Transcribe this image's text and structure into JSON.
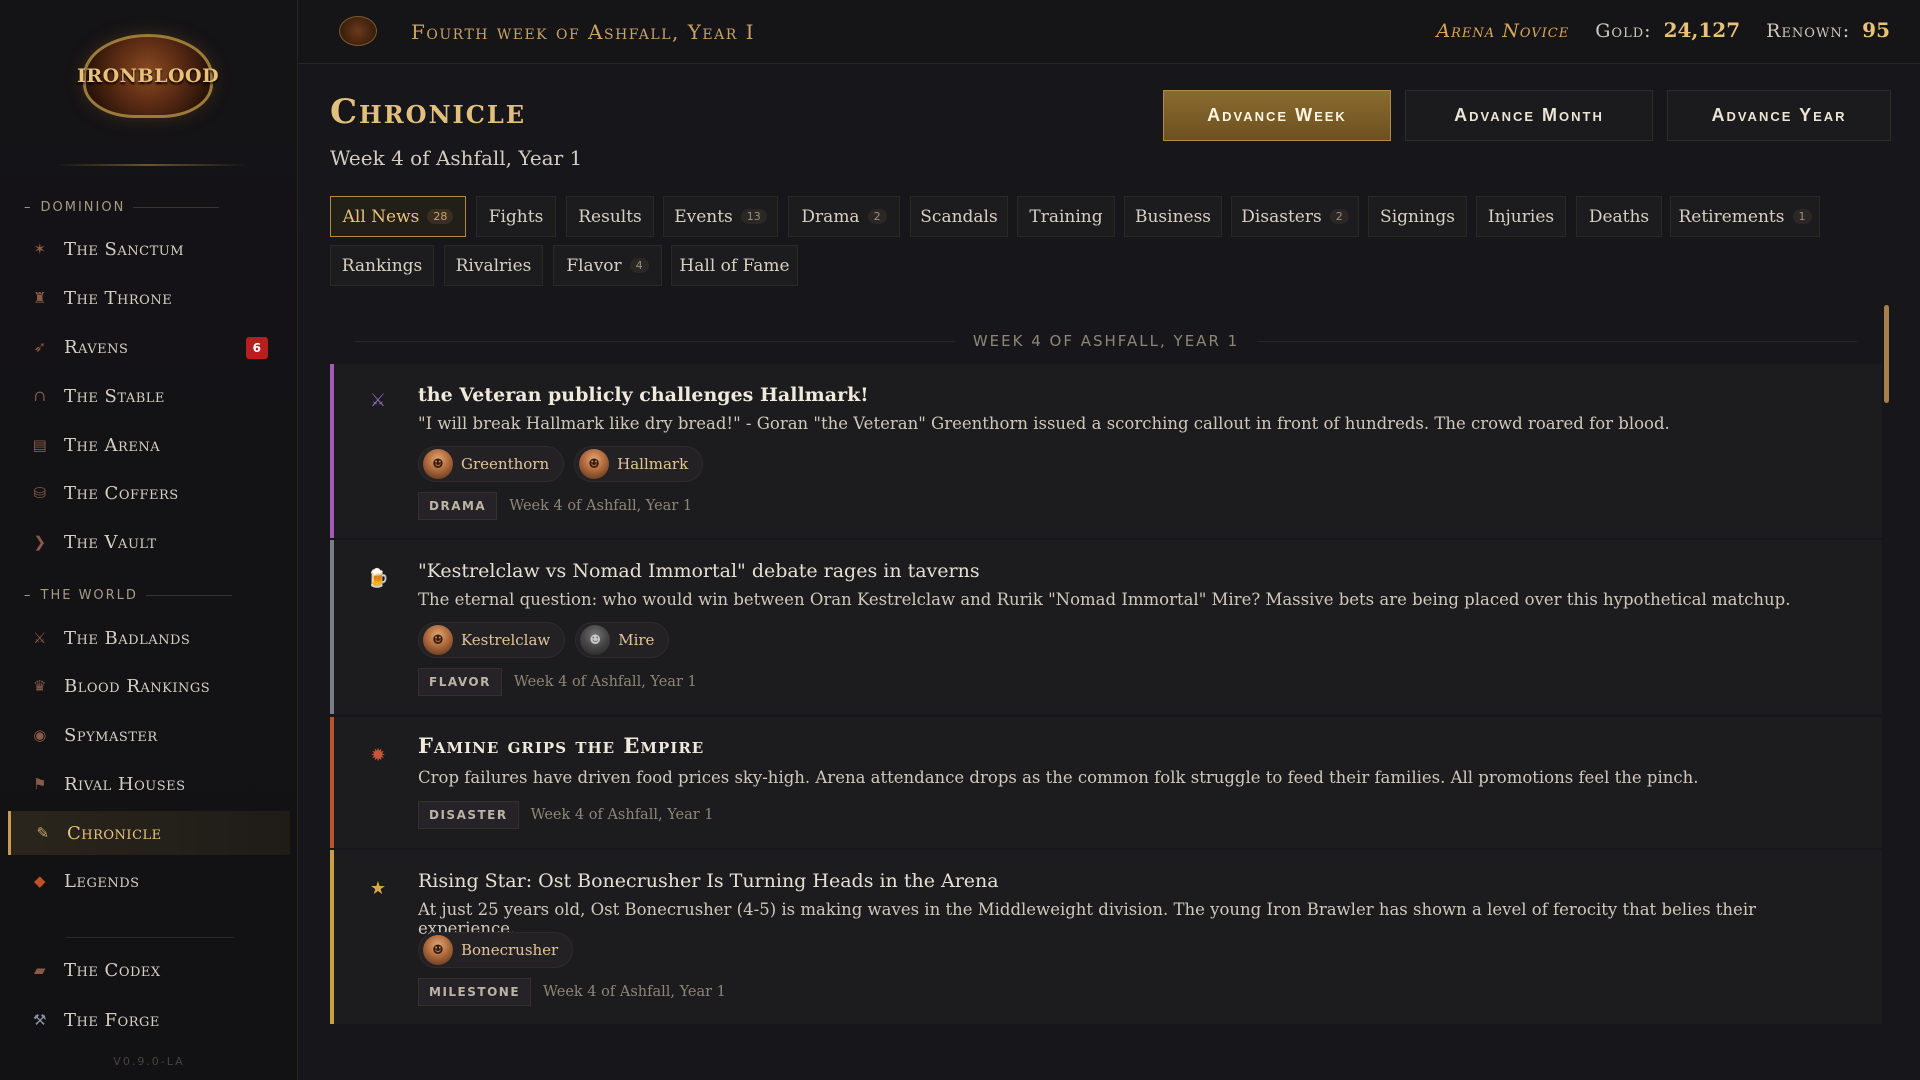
{
  "app": {
    "logo_text": "IRONBLOOD",
    "version": "V0.9.0-LA"
  },
  "topbar": {
    "date": "Fourth week of Ashfall, Year I",
    "rank": "Arena Novice",
    "gold_label": "Gold:",
    "gold_value": "24,127",
    "renown_label": "Renown:",
    "renown_value": "95"
  },
  "sidebar": {
    "sections": [
      {
        "label": "Dominion"
      },
      {
        "label": "The World"
      }
    ],
    "items": [
      {
        "label": "The Sanctum",
        "icon": "candle-icon"
      },
      {
        "label": "The Throne",
        "icon": "throne-icon"
      },
      {
        "label": "Ravens",
        "icon": "raven-icon",
        "badge": "6"
      },
      {
        "label": "The Stable",
        "icon": "horseshoe-icon"
      },
      {
        "label": "The Arena",
        "icon": "arena-icon"
      },
      {
        "label": "The Coffers",
        "icon": "chest-icon"
      },
      {
        "label": "The Vault",
        "icon": "vault-icon"
      },
      {
        "label": "The Badlands",
        "icon": "sword-icon"
      },
      {
        "label": "Blood Rankings",
        "icon": "trophy-icon"
      },
      {
        "label": "Spymaster",
        "icon": "eye-icon"
      },
      {
        "label": "Rival Houses",
        "icon": "banner-icon"
      },
      {
        "label": "Chronicle",
        "icon": "scroll-icon",
        "active": true
      },
      {
        "label": "Legends",
        "icon": "gem-icon"
      },
      {
        "label": "The Codex",
        "icon": "book-icon"
      },
      {
        "label": "The Forge",
        "icon": "hammer-icon"
      }
    ]
  },
  "header": {
    "title": "Chronicle",
    "subtitle": "Week 4 of Ashfall, Year 1",
    "buttons": {
      "advance_week": "Advance Week",
      "advance_month": "Advance Month",
      "advance_year": "Advance Year"
    }
  },
  "filters": [
    {
      "label": "All News",
      "count": "28",
      "active": true
    },
    {
      "label": "Fights"
    },
    {
      "label": "Results"
    },
    {
      "label": "Events",
      "count": "13"
    },
    {
      "label": "Drama",
      "count": "2"
    },
    {
      "label": "Scandals"
    },
    {
      "label": "Training"
    },
    {
      "label": "Business"
    },
    {
      "label": "Disasters",
      "count": "2"
    },
    {
      "label": "Signings"
    },
    {
      "label": "Injuries"
    },
    {
      "label": "Deaths"
    },
    {
      "label": "Retirements",
      "count": "1"
    },
    {
      "label": "Rankings"
    },
    {
      "label": "Rivalries"
    },
    {
      "label": "Flavor",
      "count": "4"
    },
    {
      "label": "Hall of Fame"
    }
  ],
  "feed": {
    "week_header": "WEEK 4 OF ASHFALL, YEAR 1",
    "items": [
      {
        "title": "the Veteran publicly challenges Hallmark!",
        "body": "\"I will break Hallmark like dry bread!\" - Goran \"the Veteran\" Greenthorn issued a scorching callout in front of hundreds. The crowd roared for blood.",
        "fighters": [
          "Greenthorn",
          "Hallmark"
        ],
        "category": "DRAMA",
        "date": "Week 4 of Ashfall, Year 1",
        "accent": "#a55ab8",
        "icon": "crossed-swords-icon"
      },
      {
        "title": "\"Kestrelclaw vs Nomad Immortal\" debate rages in taverns",
        "body": "The eternal question: who would win between Oran Kestrelclaw and Rurik \"Nomad Immortal\" Mire? Massive bets are being placed over this hypothetical matchup.",
        "fighters": [
          "Kestrelclaw",
          "Mire"
        ],
        "category": "FLAVOR",
        "date": "Week 4 of Ashfall, Year 1",
        "accent": "#7a7f86",
        "icon": "tankard-icon"
      },
      {
        "title": "Famine grips the Empire",
        "body": "Crop failures have driven food prices sky-high. Arena attendance drops as the common folk struggle to feed their families. All promotions feel the pinch.",
        "category": "DISASTER",
        "date": "Week 4 of Ashfall, Year 1",
        "accent": "#b4552e",
        "icon": "fire-icon"
      },
      {
        "title": "Rising Star: Ost Bonecrusher Is Turning Heads in the Arena",
        "body": "At just 25 years old, Ost Bonecrusher (4-5) is making waves in the Middleweight division. The young Iron Brawler has shown a level of ferocity that belies their experience.",
        "fighters": [
          "Bonecrusher"
        ],
        "category": "MILESTONE",
        "date": "Week 4 of Ashfall, Year 1",
        "accent": "#c9a040",
        "icon": "star-icon"
      }
    ]
  },
  "colors": {
    "accent_gold": "#e3bf7e",
    "primary_button": "#7a5c28",
    "badge_red": "#b51f1f"
  }
}
